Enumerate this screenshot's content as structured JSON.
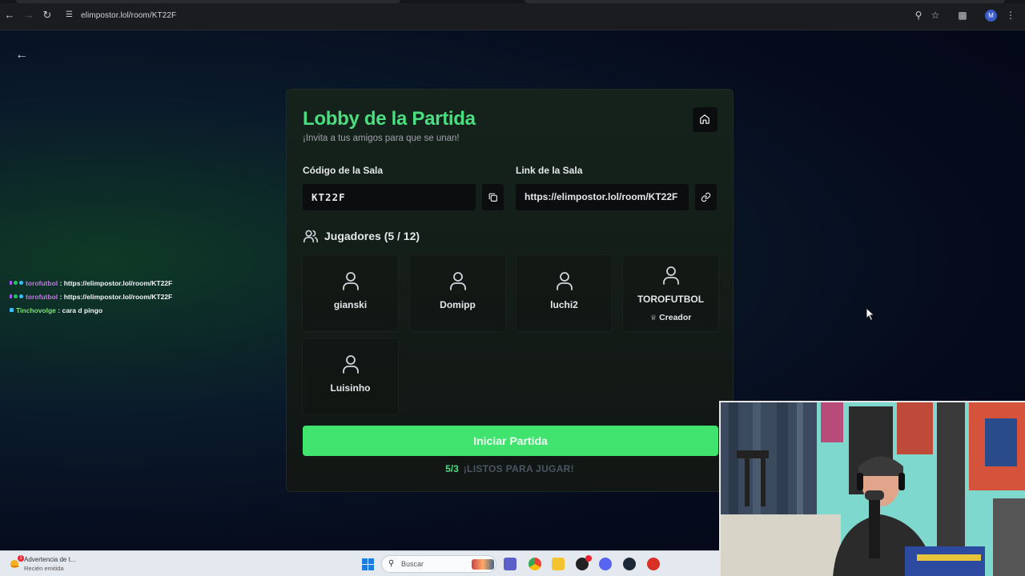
{
  "browser": {
    "url": "elimpostor.lol/room/KT22F",
    "profile_initial": "M"
  },
  "lobby": {
    "title": "Lobby de la Partida",
    "subtitle": "¡Invita a tus amigos para que se unan!",
    "room_code_label": "Código de la Sala",
    "room_code": "KT22F",
    "room_link_label": "Link de la Sala",
    "room_link": "https://elimpostor.lol/room/KT22F",
    "players_title": "Jugadores (5 / 12)",
    "players": [
      {
        "name": "gianski"
      },
      {
        "name": "Domipp"
      },
      {
        "name": "luchi2"
      },
      {
        "name": "TOROFUTBOL",
        "badge": "Creador"
      },
      {
        "name": "Luisinho"
      }
    ],
    "start_button": "Iniciar Partida",
    "ready_count": "5/3",
    "ready_text": "¡LISTOS PARA JUGAR!"
  },
  "chat": [
    {
      "user": "torofutbol",
      "message": ": https://elimpostor.lol/room/KT22F"
    },
    {
      "user": "torofutbol",
      "message": ": https://elimpostor.lol/room/KT22F"
    },
    {
      "user": "Tinchovolge",
      "message": ": cara d pingo"
    }
  ],
  "taskbar": {
    "notification_title": "Advertencia de t...",
    "notification_sub": "Recién emitida",
    "notification_count": "1",
    "search_placeholder": "Buscar"
  },
  "colors": {
    "accent": "#4ade80",
    "start_button": "#3fe36e",
    "card_bg": "#15231c"
  }
}
